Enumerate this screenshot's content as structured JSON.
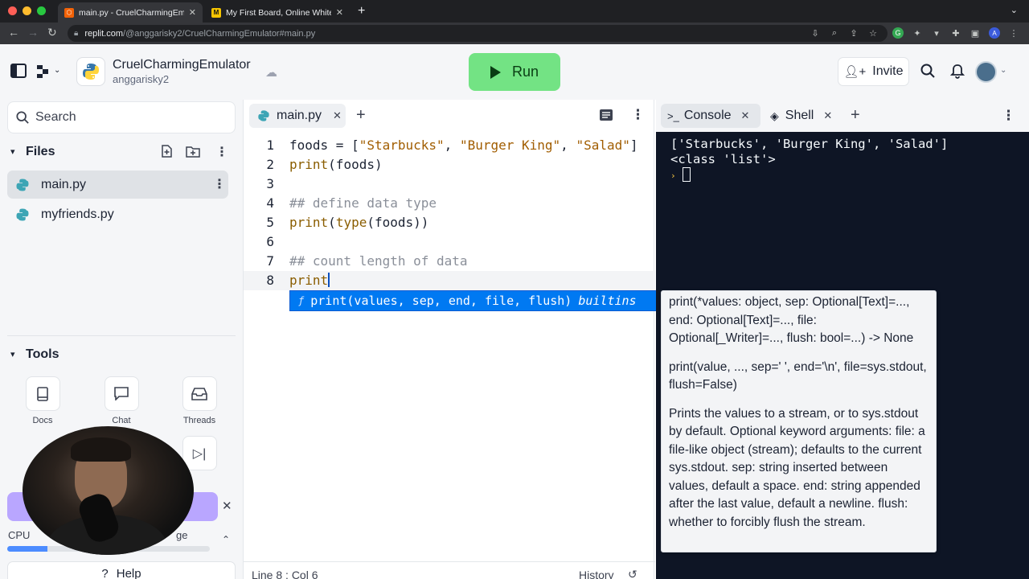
{
  "browser": {
    "tabs": [
      {
        "title": "main.py - CruelCharmingEmulat",
        "active": true
      },
      {
        "title": "My First Board, Online Whitebo",
        "active": false
      }
    ],
    "url_host": "replit.com",
    "url_path": "/@anggarisky2/CruelCharmingEmulator#main.py"
  },
  "header": {
    "project_name": "CruelCharmingEmulator",
    "username": "anggarisky2",
    "run_label": "Run",
    "invite_label": "Invite"
  },
  "sidebar": {
    "search_label": "Search",
    "files_title": "Files",
    "files": [
      {
        "name": "main.py",
        "active": true
      },
      {
        "name": "myfriends.py",
        "active": false
      }
    ],
    "tools_title": "Tools",
    "tools": [
      {
        "label": "Docs",
        "icon": "book-icon"
      },
      {
        "label": "Chat",
        "icon": "chat-icon"
      },
      {
        "label": "Threads",
        "icon": "inbox-icon"
      }
    ],
    "cpu_label": "CPU",
    "storage_label_fragment": "ge",
    "cpu_usage": 0.2,
    "help_label": "Help"
  },
  "editor": {
    "tab_label": "main.py",
    "status_position": "Line 8 : Col 6",
    "history_label": "History",
    "line_numbers": [
      "1",
      "2",
      "3",
      "4",
      "5",
      "6",
      "7",
      "8"
    ],
    "autocomplete": {
      "signature": "print(values, sep, end, file, flush)",
      "kind": "builtins"
    }
  },
  "tooltip": {
    "p1": "print(*values: object, sep: Optional[Text]=..., end: Optional[Text]=..., file: Optional[_Writer]=..., flush: bool=...) -> None",
    "p2": "print(value, ..., sep=' ', end='\\n', file=sys.stdout, flush=False)",
    "p3": "Prints the values to a stream, or to sys.stdout by default. Optional keyword arguments: file:  a file-like object (stream); defaults to the current sys.stdout. sep:  string inserted between values, default a space. end:  string appended after the last value, default a newline. flush: whether to forcibly flush the stream."
  },
  "console": {
    "tabs": [
      {
        "label": "Console",
        "active": true
      },
      {
        "label": "Shell",
        "active": false
      }
    ],
    "output": [
      "['Starbucks', 'Burger King', 'Salad']",
      "<class 'list'>"
    ]
  },
  "colors": {
    "run_green": "#73e384",
    "console_bg": "#0e1525",
    "accent_blue": "#0079f2"
  }
}
